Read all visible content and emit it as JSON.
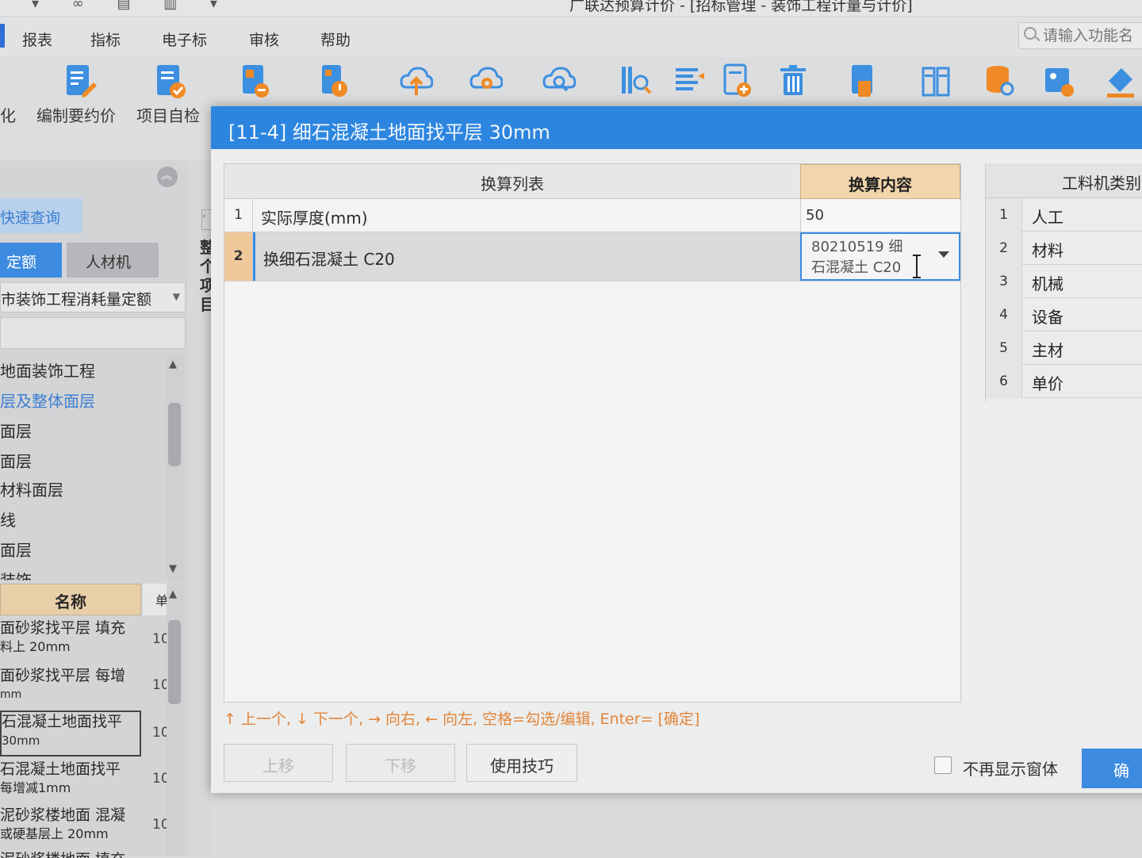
{
  "window": {
    "title": "广联达预算计价 - [招标管理 - 装饰工程计量与计价]"
  },
  "menu": {
    "items": [
      "报表",
      "指标",
      "电子标",
      "审核",
      "帮助"
    ]
  },
  "search": {
    "placeholder": "请输入功能名"
  },
  "toolbar": {
    "partial_label": "化",
    "items": [
      {
        "label": "编制要约价",
        "icon": "edit-doc-icon",
        "color": "#3d8fe0"
      },
      {
        "label": "项目自检",
        "icon": "check-doc-icon",
        "color": "#3d8fe0"
      }
    ],
    "accent_orange": "#f08a24",
    "accent_blue": "#3d8fe0"
  },
  "left_panel": {
    "quick_query": "快速查询",
    "tabs": {
      "quota": "定额",
      "materials": "人材机"
    },
    "quota_library": "市装饰工程消耗量定额",
    "tree": [
      "地面装饰工程",
      "层及整体面层",
      "面层",
      "面层",
      "材料面层",
      "线",
      "面层",
      "装饰"
    ],
    "list_header": {
      "name": "名称",
      "unit": "单"
    },
    "list": [
      {
        "line1": "面砂浆找平层 填充",
        "line2": "料上 20mm",
        "unit": "10"
      },
      {
        "line1": "面砂浆找平层 每增",
        "line2": "mm",
        "unit": "10"
      },
      {
        "line1": "石混凝土地面找平",
        "line2": "30mm",
        "unit": "10"
      },
      {
        "line1": "石混凝土地面找平",
        "line2": " 每增减1mm",
        "unit": "10"
      },
      {
        "line1": "泥砂浆楼地面 混凝",
        "line2": "或硬基层上 20mm",
        "unit": "10"
      },
      {
        "line1": "泥砂浆楼地面 填充",
        "line2": "",
        "unit": ""
      }
    ]
  },
  "mid_strip": {
    "vertical_text": "整个项目"
  },
  "dialog": {
    "title": "[11-4] 细石混凝土地面找平层 30mm",
    "table": {
      "header_list": "换算列表",
      "header_content": "换算内容",
      "rows": [
        {
          "num": "1",
          "name": "实际厚度(mm)",
          "value": "50"
        },
        {
          "num": "2",
          "name": "换细石混凝土 C20",
          "value_line1": "80210519  细",
          "value_line2": "石混凝土 C20"
        }
      ]
    },
    "hint": "↑ 上一个, ↓ 下一个, → 向右, ← 向左, 空格=勾选/编辑, Enter= [确定]",
    "buttons": {
      "up": "上移",
      "down": "下移",
      "tips": "使用技巧",
      "ok": "确"
    },
    "no_show_label": "不再显示窗体"
  },
  "right_table": {
    "header": "工料机类别",
    "rows": [
      {
        "num": "1",
        "label": "人工"
      },
      {
        "num": "2",
        "label": "材料"
      },
      {
        "num": "3",
        "label": "机械"
      },
      {
        "num": "4",
        "label": "设备"
      },
      {
        "num": "5",
        "label": "主材"
      },
      {
        "num": "6",
        "label": "单价"
      }
    ]
  }
}
